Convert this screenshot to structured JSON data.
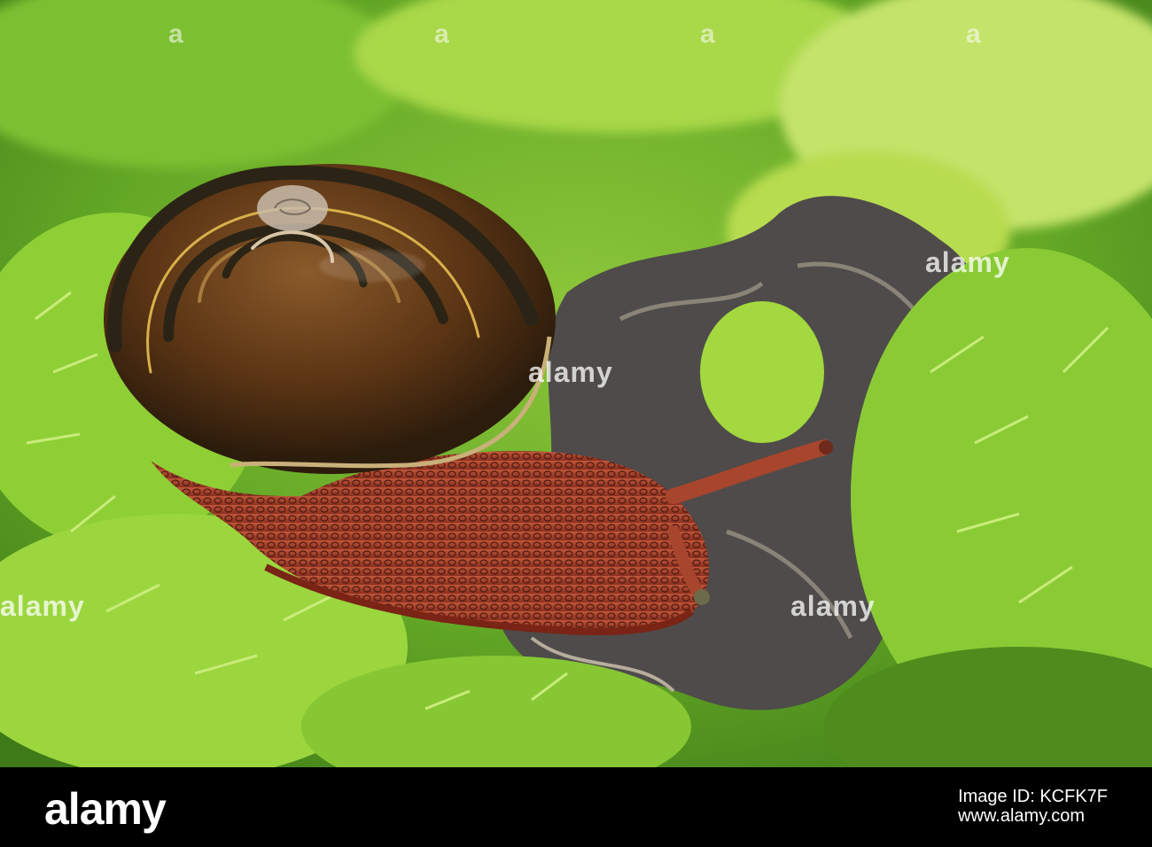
{
  "watermark": {
    "brand": "alamy"
  },
  "footer": {
    "logo": "alamy",
    "image_id_line1": "Image ID: KCFK7F",
    "image_id_line2": "www.alamy.com"
  },
  "colors": {
    "moss_bright": "#a6d93a",
    "moss_dark": "#4f8c1d",
    "shell_brown": "#6b3b16",
    "shell_band": "#2b2416",
    "body_red": "#b3462e",
    "lichen": "#4e4b4a"
  }
}
